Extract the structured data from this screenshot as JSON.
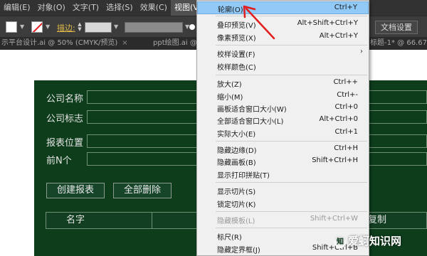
{
  "menubar": {
    "items": [
      {
        "label": "编辑(E)"
      },
      {
        "label": "对象(O)"
      },
      {
        "label": "文字(T)"
      },
      {
        "label": "选择(S)"
      },
      {
        "label": "效果(C)"
      },
      {
        "label": "视图(V)",
        "active": true
      },
      {
        "label": "窗"
      }
    ]
  },
  "control_bar": {
    "stroke_label": "描边:",
    "doc_settings_label": "文档设置",
    "stroke_color": "#e0b84a"
  },
  "tabs": [
    {
      "label": "示平台设计.ai @ 50% (CMYK/预览)"
    },
    {
      "label": "ppt绘图.ai @ 25% ("
    },
    {
      "label": "标题-1* @ 66.67"
    }
  ],
  "panel": {
    "bg_color": "#0e3d1c",
    "fields": [
      {
        "label": "公司名称"
      },
      {
        "label": "公司标志"
      },
      {
        "label": "报表位置"
      },
      {
        "label": "前N个"
      }
    ],
    "buttons": {
      "create": "创建报表",
      "delete_all": "全部删除"
    },
    "table": {
      "col1": "名字",
      "col_partial": "复制"
    }
  },
  "view_menu": {
    "highlight_color": "#91c9f7",
    "items": [
      {
        "label": "轮廓(O)",
        "shortcut": "Ctrl+Y",
        "highlighted": true
      },
      {
        "label": "叠印预览(V)",
        "shortcut": "Alt+Shift+Ctrl+Y"
      },
      {
        "label": "像素预览(X)",
        "shortcut": "Alt+Ctrl+Y"
      },
      {
        "label": "校样设置(F)",
        "shortcut": "",
        "submenu": true
      },
      {
        "label": "校样颜色(C)",
        "shortcut": ""
      },
      {
        "label": "放大(Z)",
        "shortcut": "Ctrl++"
      },
      {
        "label": "缩小(M)",
        "shortcut": "Ctrl+-"
      },
      {
        "label": "画板适合窗口大小(W)",
        "shortcut": "Ctrl+0"
      },
      {
        "label": "全部适合窗口大小(L)",
        "shortcut": "Alt+Ctrl+0"
      },
      {
        "label": "实际大小(E)",
        "shortcut": "Ctrl+1"
      },
      {
        "label": "隐藏边缘(D)",
        "shortcut": "Ctrl+H"
      },
      {
        "label": "隐藏画板(B)",
        "shortcut": "Shift+Ctrl+H"
      },
      {
        "label": "显示打印拼贴(T)",
        "shortcut": ""
      },
      {
        "label": "显示切片(S)",
        "shortcut": ""
      },
      {
        "label": "锁定切片(K)",
        "shortcut": ""
      },
      {
        "label": "隐藏模板(L)",
        "shortcut": "Shift+Ctrl+W",
        "disabled": true
      },
      {
        "label": "标尺(R)",
        "shortcut": ""
      },
      {
        "label": "隐藏定界框(J)",
        "shortcut": "Shift+Ctrl+B"
      }
    ]
  },
  "watermark": {
    "logo_text": "知",
    "text": "爱蚵知识网"
  }
}
